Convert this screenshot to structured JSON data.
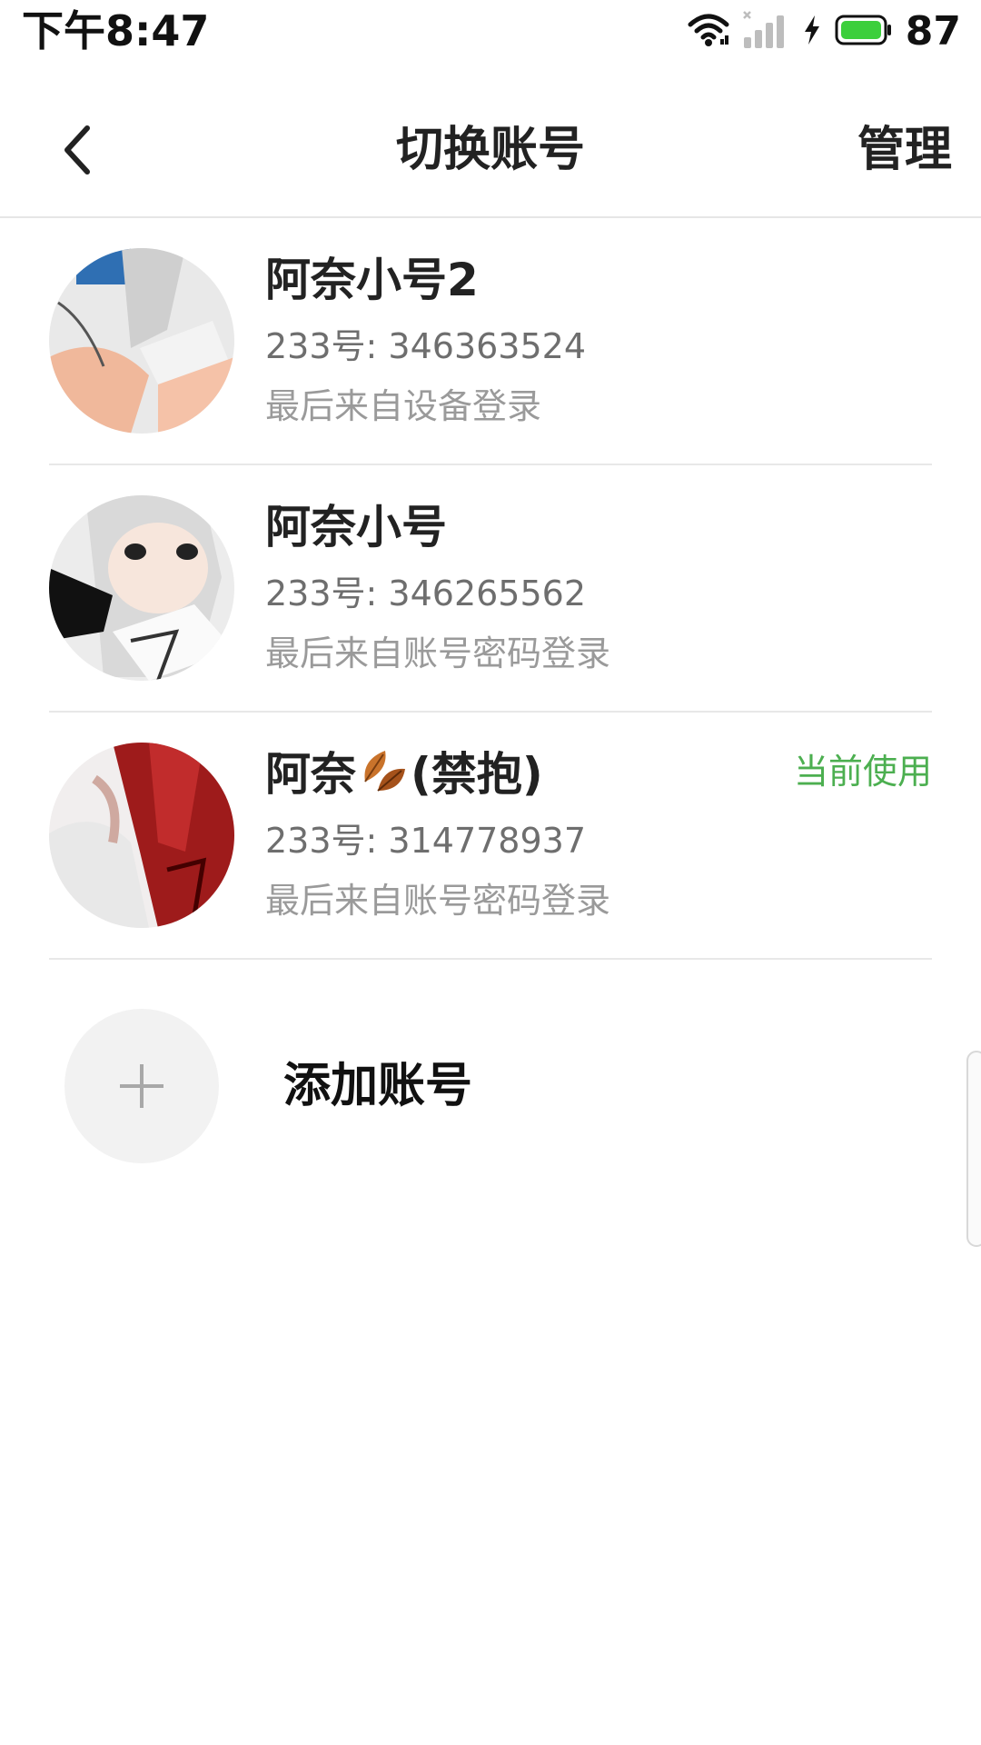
{
  "status_bar": {
    "time": "下午8:47",
    "battery": "87",
    "icons": [
      "wifi-icon",
      "signal-icon",
      "charging-icon",
      "battery-icon"
    ]
  },
  "header": {
    "back_icon": "chevron-left-icon",
    "title": "切换账号",
    "manage_label": "管理"
  },
  "accounts": [
    {
      "name": "阿奈小号2",
      "id_line": "233号: 346363524",
      "login_line": "最后来自设备登录",
      "current_label": ""
    },
    {
      "name": "阿奈小号",
      "id_line": "233号: 346265562",
      "login_line": "最后来自账号密码登录",
      "current_label": ""
    },
    {
      "name_prefix": "阿奈",
      "name_suffix": "(禁抱)",
      "name_emoji": "fallen-leaf-icon",
      "id_line": "233号: 314778937",
      "login_line": "最后来自账号密码登录",
      "current_label": "当前使用"
    }
  ],
  "add_account": {
    "icon": "plus-icon",
    "label": "添加账号"
  },
  "colors": {
    "accent_current": "#4caf50",
    "battery_fill": "#3ccf3c",
    "divider": "#e8e8e8",
    "add_circle": "#f2f2f2"
  }
}
